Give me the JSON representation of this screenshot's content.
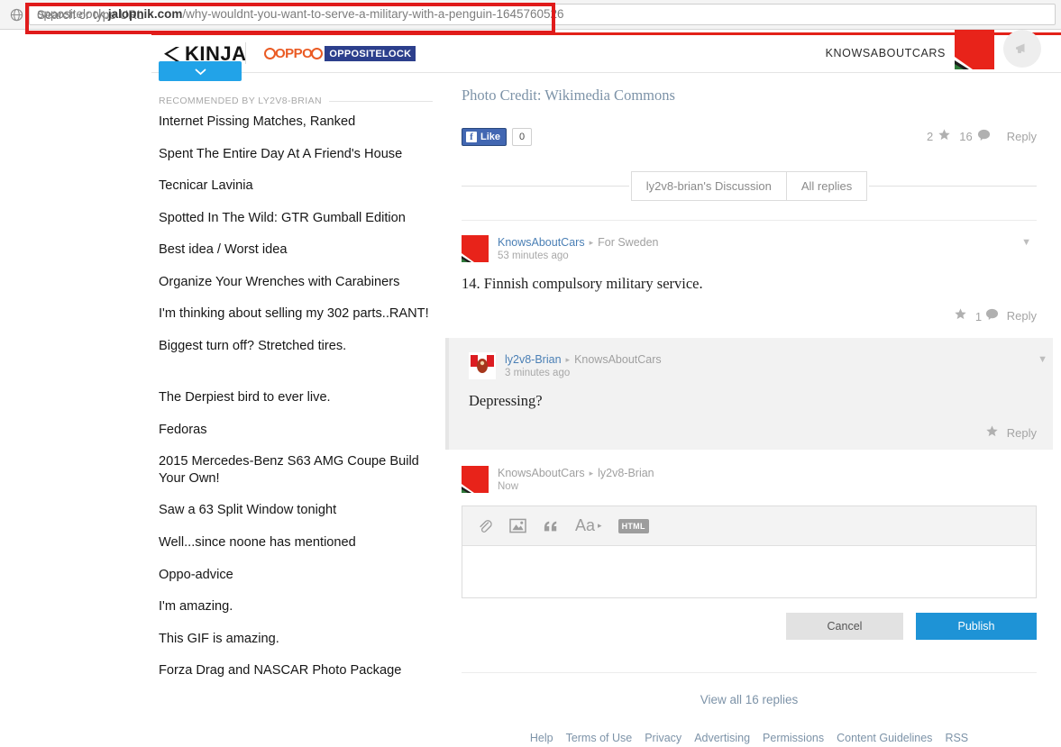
{
  "browser": {
    "favicon": "globe-icon",
    "url_host_strong": "oppositelock.",
    "url_host_bold": "jalopnik.com",
    "url_path": "/why-wouldnt-you-want-to-serve-a-military-with-a-penguin-1645760526",
    "url_full": "oppositelock.jalopnik.com/why-wouldnt-you-want-to-serve-a-military-with-a-penguin-1645760526",
    "url_placeholder": "Search or type URL",
    "highlight_color": "#e01b1b"
  },
  "header": {
    "logo": "KINJA",
    "blog_mark": "OPPO",
    "blog_name": "OPPOSITELOCK",
    "user_name": "KNOWSABOUTCARS",
    "avatar": "user-avatar-flag",
    "notify_icon": "megaphone-icon",
    "accent_red": "#e32119",
    "accent_blue": "#2c3f8c",
    "accent_orange": "#ea5b24"
  },
  "sidebar": {
    "expand_icon": "chevron-down-icon",
    "expand_color": "#22a3e8",
    "recommended_label": "RECOMMENDED BY LY2V8-BRIAN",
    "items": [
      {
        "label": "Internet Pissing Matches, Ranked"
      },
      {
        "label": "Spent The Entire Day At A Friend's House"
      },
      {
        "label": "Tecnicar Lavinia"
      },
      {
        "label": "Spotted In The Wild: GTR Gumball Edition"
      },
      {
        "label": "Best idea / Worst idea"
      },
      {
        "label": "Organize Your Wrenches with Carabiners"
      },
      {
        "label": "I'm thinking about selling my 302 parts..RANT!"
      },
      {
        "label": "Biggest turn off? Stretched tires."
      },
      {
        "label": "The Derpiest bird to ever live."
      },
      {
        "label": "Fedoras"
      },
      {
        "label": "2015 Mercedes-Benz S63 AMG Coupe Build Your Own!"
      },
      {
        "label": "Saw a 63 Split Window tonight"
      },
      {
        "label": "Well...since noone has mentioned"
      },
      {
        "label": "Oppo-advice"
      },
      {
        "label": "I'm amazing."
      },
      {
        "label": "This GIF is amazing."
      },
      {
        "label": "Forza Drag and NASCAR Photo Package"
      }
    ]
  },
  "main": {
    "photo_credit": "Photo Credit: Wikimedia Commons",
    "facebook": {
      "f_glyph": "f",
      "like_label": "Like",
      "count": "0"
    },
    "post_stats": {
      "star_count": "2",
      "comment_count": "16",
      "reply_label": "Reply",
      "star_icon": "star-icon",
      "comment_icon": "speech-bubble-icon"
    },
    "tabs": [
      {
        "label": "ly2v8-brian's Discussion",
        "active": true
      },
      {
        "label": "All replies",
        "active": false
      }
    ],
    "comments": [
      {
        "author": "KnowsAboutCars",
        "arrow": "▸",
        "target": "For Sweden",
        "time": "53 minutes ago",
        "body": "14. Finnish compulsory military service.",
        "star_count": "",
        "comment_count": "1",
        "reply_label": "Reply",
        "avatar": "knowsaboutcars-avatar",
        "caret_icon": "chevron-down-icon"
      },
      {
        "author": "ly2v8-Brian",
        "arrow": "▸",
        "target": "KnowsAboutCars",
        "time": "3 minutes ago",
        "body": "Depressing?",
        "star_count": "",
        "comment_count": "",
        "reply_label": "Reply",
        "avatar": "ly2v8-brian-avatar",
        "caret_icon": "chevron-down-icon"
      }
    ],
    "composer": {
      "author": "KnowsAboutCars",
      "arrow": "▸",
      "target": "ly2v8-Brian",
      "time": "Now",
      "avatar": "knowsaboutcars-avatar",
      "value": "",
      "placeholder": "",
      "tools": [
        {
          "name": "attachment-icon",
          "label": "📎"
        },
        {
          "name": "image-icon",
          "label": ""
        },
        {
          "name": "quote-icon",
          "label": "“"
        },
        {
          "name": "text-format-icon",
          "label": "Aa"
        },
        {
          "name": "html-icon",
          "label": "HTML"
        }
      ],
      "cancel_label": "Cancel",
      "publish_label": "Publish",
      "publish_color": "#1e93d6"
    },
    "view_all_replies": "View all 16 replies"
  },
  "footer": {
    "links": [
      {
        "label": "Help"
      },
      {
        "label": "Terms of Use"
      },
      {
        "label": "Privacy"
      },
      {
        "label": "Advertising"
      },
      {
        "label": "Permissions"
      },
      {
        "label": "Content Guidelines"
      },
      {
        "label": "RSS"
      }
    ]
  }
}
